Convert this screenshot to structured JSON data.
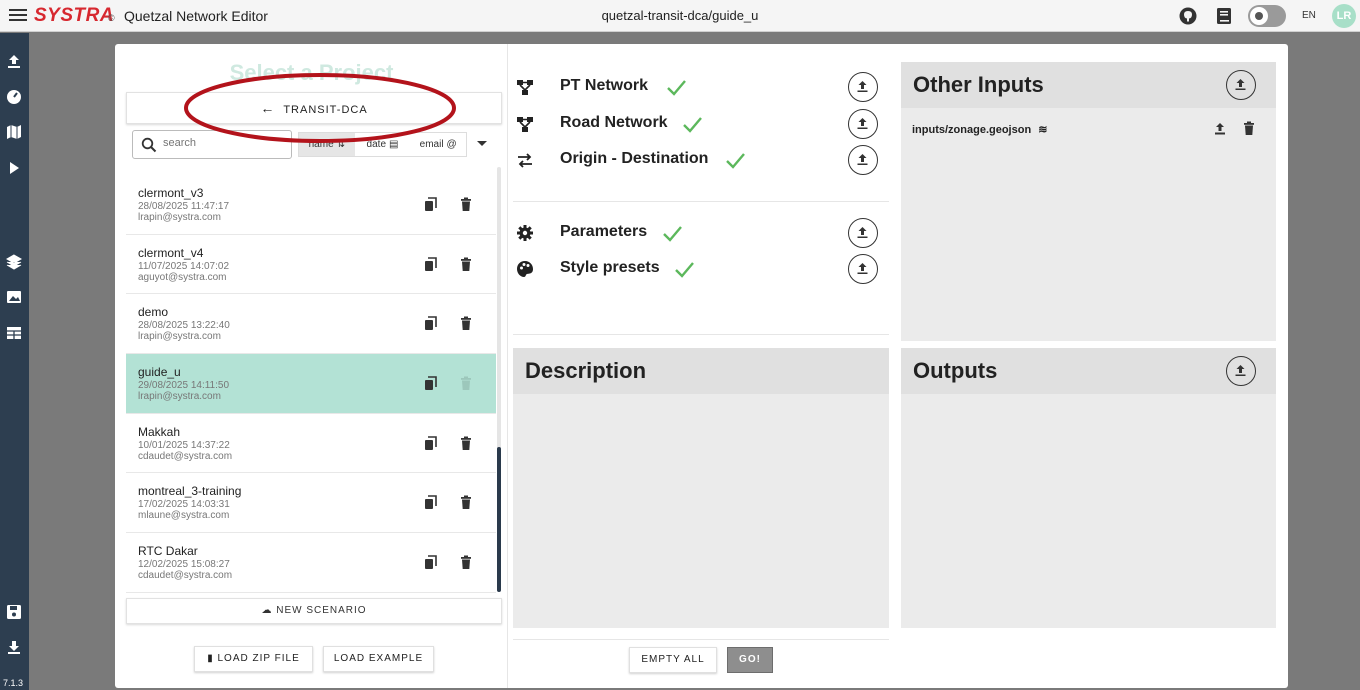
{
  "header": {
    "logo": "SYSTRA",
    "logo_mark": "©",
    "app_title": "Quetzal Network Editor",
    "center_title": "quetzal-transit-dca/guide_u",
    "lang": "EN",
    "avatar": "LR"
  },
  "sidebar": {
    "version": "7.1.3",
    "items": [
      "upload-icon",
      "dashboard-icon",
      "map-icon",
      "play-icon",
      "layers-icon",
      "images-icon",
      "table-icon",
      "save-icon",
      "download-icon"
    ]
  },
  "projects": {
    "title": "Select a Project",
    "back_label": "TRANSIT-DCA",
    "search_placeholder": "search",
    "sort": [
      "name",
      "date",
      "email"
    ],
    "items": [
      {
        "name": "clermont_v3",
        "date": "28/08/2025 11:47:17",
        "email": "lrapin@systra.com",
        "selected": false
      },
      {
        "name": "clermont_v4",
        "date": "11/07/2025 14:07:02",
        "email": "aguyot@systra.com",
        "selected": false
      },
      {
        "name": "demo",
        "date": "28/08/2025 13:22:40",
        "email": "lrapin@systra.com",
        "selected": false
      },
      {
        "name": "guide_u",
        "date": "29/08/2025 14:11:50",
        "email": "lrapin@systra.com",
        "selected": true
      },
      {
        "name": "Makkah",
        "date": "10/01/2025 14:37:22",
        "email": "cdaudet@systra.com",
        "selected": false
      },
      {
        "name": "montreal_3-training",
        "date": "17/02/2025 14:03:31",
        "email": "mlaune@systra.com",
        "selected": false
      },
      {
        "name": "RTC Dakar",
        "date": "12/02/2025 15:08:27",
        "email": "cdaudet@systra.com",
        "selected": false
      }
    ],
    "new_scenario": "NEW SCENARIO",
    "load_zip": "LOAD ZIP FILE",
    "load_example": "LOAD EXAMPLE"
  },
  "inputs": {
    "pt_network": "PT Network",
    "road_network": "Road Network",
    "od": "Origin - Destination",
    "parameters": "Parameters",
    "style_presets": "Style presets"
  },
  "description": {
    "title": "Description"
  },
  "other_inputs": {
    "title": "Other Inputs",
    "file": "inputs/zonage.geojson"
  },
  "outputs": {
    "title": "Outputs"
  },
  "actions": {
    "empty_all": "EMPTY ALL",
    "go": "GO!"
  },
  "colors": {
    "accent": "#b3e2d5",
    "brand": "#d7282f",
    "sidebar": "#2d3e50",
    "check": "#5cb85c"
  }
}
